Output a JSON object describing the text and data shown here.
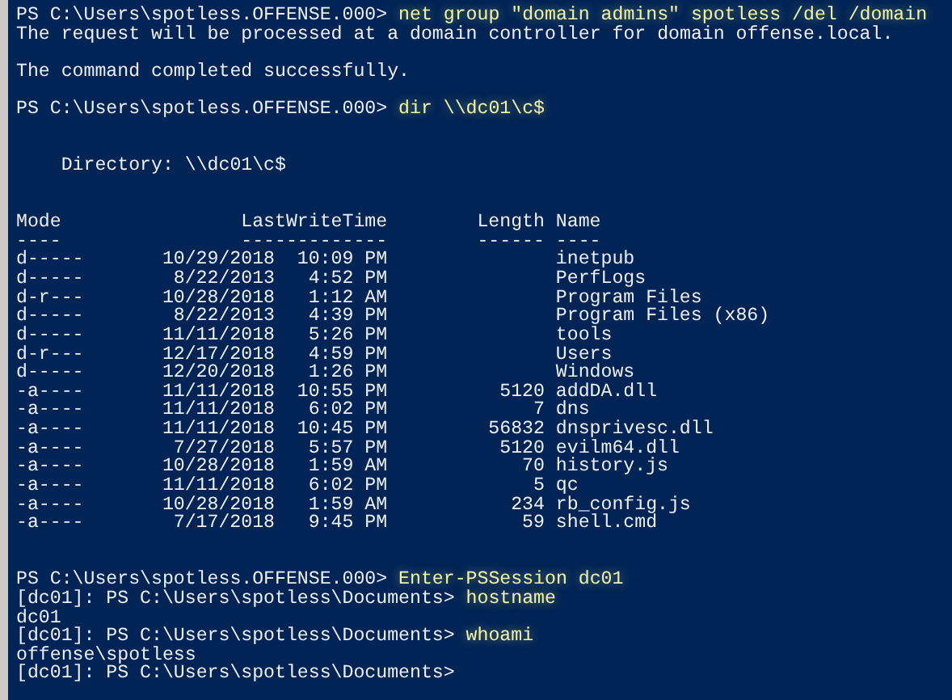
{
  "console": {
    "blocks": [
      {
        "kind": "prompt",
        "prompt": "PS C:\\Users\\spotless.OFFENSE.000>",
        "command": "net group \"domain admins\" spotless /del /domain"
      },
      {
        "kind": "output",
        "text": "The request will be processed at a domain controller for domain offense.local."
      },
      {
        "kind": "blank"
      },
      {
        "kind": "output",
        "text": "The command completed successfully."
      },
      {
        "kind": "blank"
      },
      {
        "kind": "prompt",
        "prompt": "PS C:\\Users\\spotless.OFFENSE.000>",
        "command": "dir \\\\dc01\\c$"
      },
      {
        "kind": "blank"
      },
      {
        "kind": "blank"
      },
      {
        "kind": "directory",
        "text": "Directory: \\\\dc01\\c$"
      },
      {
        "kind": "blank"
      },
      {
        "kind": "blank"
      },
      {
        "kind": "listing",
        "columns": [
          {
            "label": "Mode",
            "rule": "----"
          },
          {
            "label": "LastWriteTime",
            "rule": "-------------"
          },
          {
            "label": "Length",
            "rule": "------"
          },
          {
            "label": "Name",
            "rule": "----"
          }
        ],
        "rows": [
          {
            "mode": "d-----",
            "date": "10/29/2018",
            "time": "10:09 PM",
            "name": "inetpub"
          },
          {
            "mode": "d-----",
            "date": "8/22/2013",
            "time": "4:52 PM",
            "name": "PerfLogs"
          },
          {
            "mode": "d-r---",
            "date": "10/28/2018",
            "time": "1:12 AM",
            "name": "Program Files"
          },
          {
            "mode": "d-----",
            "date": "8/22/2013",
            "time": "4:39 PM",
            "name": "Program Files (x86)"
          },
          {
            "mode": "d-----",
            "date": "11/11/2018",
            "time": "5:26 PM",
            "name": "tools"
          },
          {
            "mode": "d-r---",
            "date": "12/17/2018",
            "time": "4:59 PM",
            "name": "Users"
          },
          {
            "mode": "d-----",
            "date": "12/20/2018",
            "time": "1:26 PM",
            "name": "Windows"
          },
          {
            "mode": "-a----",
            "date": "11/11/2018",
            "time": "10:55 PM",
            "length": "5120",
            "name": "addDA.dll"
          },
          {
            "mode": "-a----",
            "date": "11/11/2018",
            "time": "6:02 PM",
            "length": "7",
            "name": "dns"
          },
          {
            "mode": "-a----",
            "date": "11/11/2018",
            "time": "10:45 PM",
            "length": "56832",
            "name": "dnsprivesc.dll"
          },
          {
            "mode": "-a----",
            "date": "7/27/2018",
            "time": "5:57 PM",
            "length": "5120",
            "name": "evilm64.dll"
          },
          {
            "mode": "-a----",
            "date": "10/28/2018",
            "time": "1:59 AM",
            "length": "70",
            "name": "history.js"
          },
          {
            "mode": "-a----",
            "date": "11/11/2018",
            "time": "6:02 PM",
            "length": "5",
            "name": "qc"
          },
          {
            "mode": "-a----",
            "date": "10/28/2018",
            "time": "1:59 AM",
            "length": "234",
            "name": "rb_config.js"
          },
          {
            "mode": "-a----",
            "date": "7/17/2018",
            "time": "9:45 PM",
            "length": "59",
            "name": "shell.cmd"
          }
        ]
      },
      {
        "kind": "blank"
      },
      {
        "kind": "blank"
      },
      {
        "kind": "prompt",
        "prompt": "PS C:\\Users\\spotless.OFFENSE.000>",
        "command": "Enter-PSSession dc01"
      },
      {
        "kind": "prompt",
        "prompt": "[dc01]: PS C:\\Users\\spotless\\Documents>",
        "command": "hostname"
      },
      {
        "kind": "output",
        "text": "dc01"
      },
      {
        "kind": "prompt",
        "prompt": "[dc01]: PS C:\\Users\\spotless\\Documents>",
        "command": "whoami"
      },
      {
        "kind": "output",
        "text": "offense\\spotless"
      },
      {
        "kind": "prompt",
        "prompt": "[dc01]: PS C:\\Users\\spotless\\Documents>"
      }
    ]
  }
}
